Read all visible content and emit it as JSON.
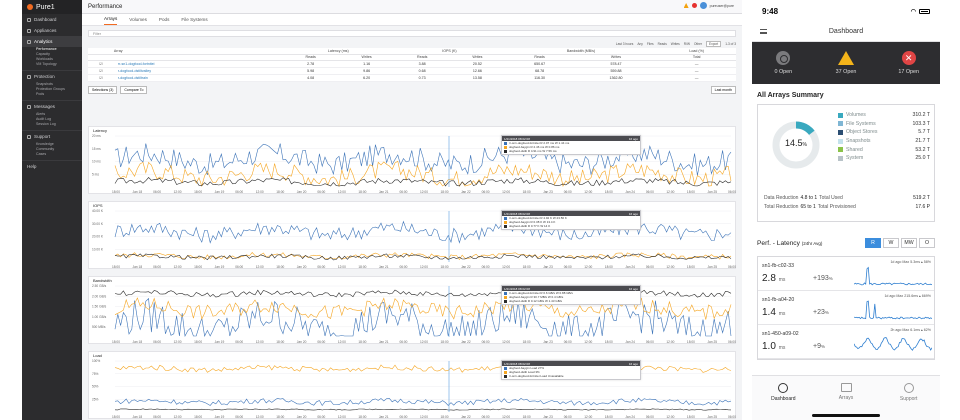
{
  "desktop": {
    "brand": "Pure1",
    "sidebar": {
      "top": [
        {
          "label": "Dashboard"
        },
        {
          "label": "Appliances"
        }
      ],
      "groups": [
        {
          "label": "Analytics",
          "active": true,
          "subs": [
            {
              "label": "Performance",
              "active": true
            },
            {
              "label": "Capacity"
            },
            {
              "label": "Workloads"
            },
            {
              "label": "VM Topology"
            }
          ]
        },
        {
          "label": "Protection",
          "subs": [
            {
              "label": "Snapshots"
            },
            {
              "label": "Protection Groups"
            },
            {
              "label": "Pods"
            }
          ]
        },
        {
          "label": "Messages",
          "subs": [
            {
              "label": "Alerts"
            },
            {
              "label": "Audit Log"
            },
            {
              "label": "Session Log"
            }
          ]
        },
        {
          "label": "Support",
          "subs": [
            {
              "label": "Knowledge"
            },
            {
              "label": "Community"
            },
            {
              "label": "Cases"
            }
          ]
        }
      ],
      "help": "Help"
    },
    "page_title": "Performance",
    "user": "pureuser@pure",
    "tabs": [
      "Arrays",
      "Volumes",
      "Pods",
      "File Systems"
    ],
    "filter_placeholder": "Filter",
    "toolbar": {
      "last_hours": "Last 3 hours",
      "any": "Any",
      "files": "Files",
      "reads": "Reads",
      "writes": "Writes",
      "rw": "R/W",
      "other": "Other",
      "export": "Export",
      "page": "1-3 of 3"
    },
    "table": {
      "headers": {
        "array": "Array",
        "latency": "Latency (ms)",
        "iops": "IOPS (K)",
        "bandwidth": "Bandwidth (MB/s)",
        "load": "Load (%)",
        "reads": "Reads",
        "writes": "Writes",
        "total": "Total"
      },
      "rows": [
        {
          "name": "rr-sn1-dogfood-fortnitei",
          "lat_r": "2.78",
          "lat_w": "1.16",
          "iops_r": "3.88",
          "iops_w": "20.52",
          "bw_r": "650.67",
          "bw_w": "578.47",
          "load": "—"
        },
        {
          "name": "r-dogfood-dstiltvalley",
          "lat_r": "5.98",
          "lat_w": "9.86",
          "iops_r": "0.68",
          "iops_w": "12.66",
          "bw_r": "68.78",
          "bw_w": "559.88",
          "load": "—"
        },
        {
          "name": "r-dogfood-dstiltrain",
          "lat_r": "4.08",
          "lat_w": "6.20",
          "iops_r": "0.73",
          "iops_w": "13.58",
          "bw_r": "116.30",
          "bw_w": "1362.80",
          "load": "—"
        }
      ]
    },
    "actions": {
      "selections": "Selections (3)",
      "compare": "Compare To",
      "last_month": "Last month"
    },
    "charts": [
      {
        "title": "Latency",
        "yticks": [
          "20 ms",
          "15 ms",
          "10 ms",
          "5 ms"
        ],
        "tip_time": "1/21/2018 08:02:08",
        "tip_ago": "16 ago",
        "tip_rows": [
          "rr-sn1-dogfood-fortnitei  R 2.07 ms  W 1.44 ms",
          "dogfood-baygin  R 2.46 ms  W 0.86 ms",
          "dogfood-dstilt  R 4.91 ms  W 7.56 ms"
        ]
      },
      {
        "title": "IOPS",
        "yticks": [
          "40.00 K",
          "30.00 K",
          "20.00 K",
          "10.00 K"
        ],
        "tip_time": "1/21/2018 08:02:08",
        "tip_ago": "16 ago",
        "tip_rows": [
          "rr-sn1-dogfood-fortnitei  R 4.92 K  W 23.56 K",
          "dogfood-baygin  R 0.38 K  W 13.4 K",
          "dogfood-dstilt  R 0.77 K  W 14 K"
        ]
      },
      {
        "title": "Bandwidth",
        "yticks": [
          "2.50 GB/s",
          "2.00 GB/s",
          "1.50 GB/s",
          "1.00 GB/s",
          "500 MB/s"
        ],
        "tip_time": "1/21/2018 08:02:08",
        "tip_ago": "16 ago",
        "tip_rows": [
          "rr-sn1-dogfood-fortnitei  R 0.6 GB/s  W 0.88 GB/s",
          "dogfood-baygin  R 30.7 MB/s  W 0.4 GB/s",
          "dogfood-dstilt  R 0.12 GB/s  W 1.43 GB/s"
        ]
      },
      {
        "title": "Load",
        "yticks": [
          "100%",
          "75%",
          "50%",
          "25%"
        ],
        "tip_time": "1/21/2018 08:02:08",
        "tip_ago": "16 ago",
        "tip_rows": [
          "dogfood-baygin  Load  27%",
          "dogfood-dstilt  Load  3%",
          "rr-sn1-dogfood-fortnitei  Load  Unavailable"
        ]
      }
    ],
    "xticks": [
      "18:00",
      "Jan 18",
      "06:00",
      "12:00",
      "18:00",
      "Jan 19",
      "06:00",
      "12:00",
      "18:00",
      "Jan 20",
      "06:00",
      "12:00",
      "18:00",
      "Jan 21",
      "06:00",
      "12:00",
      "18:00",
      "Jan 22",
      "06:00",
      "12:00",
      "18:00",
      "Jan 23",
      "06:00",
      "12:00",
      "18:00",
      "Jan 24",
      "06:00",
      "12:00",
      "18:00",
      "Jan 25",
      "06:00"
    ],
    "colors": {
      "series1": "#3d74b8",
      "series2": "#f5a623",
      "series3": "#2a2a2a",
      "accent": "#f26b21"
    }
  },
  "mobile": {
    "time": "9:48",
    "title": "Dashboard",
    "alerts": [
      {
        "label": "0 Open"
      },
      {
        "label": "37 Open"
      },
      {
        "label": "17 Open"
      }
    ],
    "summary": {
      "title": "All Arrays Summary",
      "percent": "14.5",
      "percent_unit": "%",
      "legend": [
        {
          "label": "Volumes",
          "value": "310.2 T",
          "color": "#39a9bf"
        },
        {
          "label": "File Systems",
          "value": "103.3 T",
          "color": "#7fb6d4"
        },
        {
          "label": "Object Stores",
          "value": "5.7 T",
          "color": "#2c4f73"
        },
        {
          "label": "Snapshots",
          "value": "21.7 T",
          "color": "#c4e2ec"
        },
        {
          "label": "Shared",
          "value": "53.2 T",
          "color": "#8bc34a"
        },
        {
          "label": "System",
          "value": "25.0 T",
          "color": "#b8c3c8"
        }
      ],
      "donut_pct": 14.5,
      "data_reduction": {
        "label": "Data Reduction",
        "value": "4.8 to 1",
        "total_label": "Total Used",
        "total": "519.2 T"
      },
      "total_reduction": {
        "label": "Total Reduction",
        "value": "65 to 1",
        "total_label": "Total Provisioned",
        "total": "17.6 P"
      }
    },
    "perf": {
      "title": "Perf. - Latency",
      "sub": "(24hr Avg)",
      "seg": [
        "R",
        "W",
        "MW",
        "O"
      ],
      "rows": [
        {
          "name": "sn1-fb-c02-33",
          "value": "2.8",
          "unit": "ms",
          "change": "+193",
          "change_unit": "%",
          "note": "1d ago Max 5.3ms ▴ 58%"
        },
        {
          "name": "sn1-fb-a04-20",
          "value": "1.4",
          "unit": "ms",
          "change": "+23",
          "change_unit": "%",
          "note": "1d ago Max 215.6ms ▴ 669%"
        },
        {
          "name": "sn1-450-a09-02",
          "value": "1.0",
          "unit": "ms",
          "change": "+9",
          "change_unit": "%",
          "note": "2h ago Max 6.1ms ▴ 62%"
        }
      ]
    },
    "tabs": [
      "Dashboard",
      "Arrays",
      "Support"
    ]
  }
}
